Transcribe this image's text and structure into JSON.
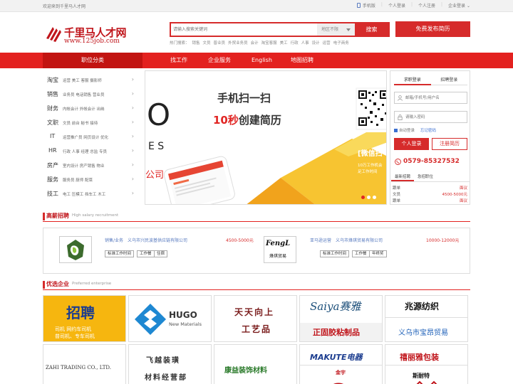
{
  "topbar": {
    "welcome": "欢迎来到千里马人才网",
    "links": [
      "手机版",
      "个人登录",
      "个人注册",
      "企业登录"
    ]
  },
  "logo": {
    "name": "千里马人才网",
    "url": "www.125job.com"
  },
  "search": {
    "placeholder": "请输入搜索关键词",
    "area": "地区不限",
    "button": "搜索",
    "hot_label": "热门搜索：",
    "hot": [
      "销售",
      "文员",
      "普业员",
      "外贸业务员",
      "会计",
      "淘宝客服",
      "美工",
      "行政",
      "人事",
      "设计",
      "运营",
      "电子商务"
    ]
  },
  "post_resume_button": "免费发布简历",
  "nav": {
    "category_label": "职位分类",
    "items": [
      "找工作",
      "企业服务",
      "English",
      "地图招聘"
    ]
  },
  "categories": [
    {
      "key": "淘宝",
      "sub": "运营 美工 客服 摄影师"
    },
    {
      "key": "销售",
      "sub": "业务员 电话销售 营业员"
    },
    {
      "key": "财务",
      "sub": "内帐会计 外帐会计 出纳"
    },
    {
      "key": "文职",
      "sub": "文员 前台 秘书 接待"
    },
    {
      "key": "IT",
      "sub": "运营推广员 网页设计 优化"
    },
    {
      "key": "HR",
      "sub": "行政 人事 经理 总监 专员"
    },
    {
      "key": "房产",
      "sub": "室内设计 房产销售 物业"
    },
    {
      "key": "服务",
      "sub": "服务员 厨师 配菜"
    },
    {
      "key": "技工",
      "sub": "电工 压模工 挡车工 木工"
    }
  ],
  "banner": {
    "line1": "手机扫一扫",
    "line2_prefix": "10秒",
    "line2_suffix": "创建简历",
    "wechat_label": "[微信扫",
    "wechat_sub1": "10万工作机会",
    "wechat_sub2": "足工作时间"
  },
  "login": {
    "tabs": [
      "求职登录",
      "招聘登录"
    ],
    "username_placeholder": "邮箱/手机号/用户名",
    "password_placeholder": "请输入密码",
    "auto_login": "自动登录",
    "forgot": "忘记密码",
    "login_button": "个人登录",
    "register_button": "注册简历",
    "hotline": "0579-85327532"
  },
  "recent": {
    "tabs": [
      "最新招聘",
      "急招职位"
    ],
    "rows": [
      {
        "left": "跟单",
        "right": "面议"
      },
      {
        "left": "文员",
        "right": "4500-5000元"
      },
      {
        "left": "跟单",
        "right": "面议"
      }
    ]
  },
  "salary_section": {
    "title_cn": "高薪招聘",
    "title_en": "High salary recruitment",
    "jobs": [
      {
        "title": "销售/业务",
        "company": "义乌市兴民波基供应链有限公司",
        "pay": "4500-5000元",
        "tags": [
          "标准工作时间",
          "工作餐",
          "住宿"
        ]
      },
      {
        "title": "亚马逊运营",
        "company": "义乌市烽琪贸易有限公司",
        "pay": "10000-12000元",
        "tags": [
          "标准工作时间",
          "工作餐",
          "年终奖"
        ]
      }
    ],
    "logo2_text": "FengL",
    "logo2_sub": "烽琪贸易"
  },
  "enterprise_section": {
    "title_cn": "优选企业",
    "title_en": "Preferred enterprise",
    "row1": [
      {
        "name": "招聘",
        "sub1": "司机 网约车司机",
        "sub2": "普司机、专车司机"
      },
      {
        "name": "HUGO",
        "sub": "New Materials"
      },
      {
        "name": "天天向上",
        "sub": "工艺品"
      },
      {
        "name": "Saiya赛雅",
        "sub": "正固胶粘制品"
      },
      {
        "name": "兆源纺织",
        "sub": "义乌市宝昂贸易"
      }
    ],
    "row2": [
      {
        "name": "ZAHI TRADING CO., LTD."
      },
      {
        "name": "飞越装璜",
        "sub": "材料经营部"
      },
      {
        "name": "康益装饰材料"
      },
      {
        "name": "MAKUTE电器",
        "sub": "金宇"
      },
      {
        "name": "禧丽雅包装",
        "sub": "斯耐特"
      }
    ]
  },
  "colors": {
    "brand_red": "#d62b2b",
    "nav_red": "#e3211f",
    "nav_dark": "#c21411"
  }
}
